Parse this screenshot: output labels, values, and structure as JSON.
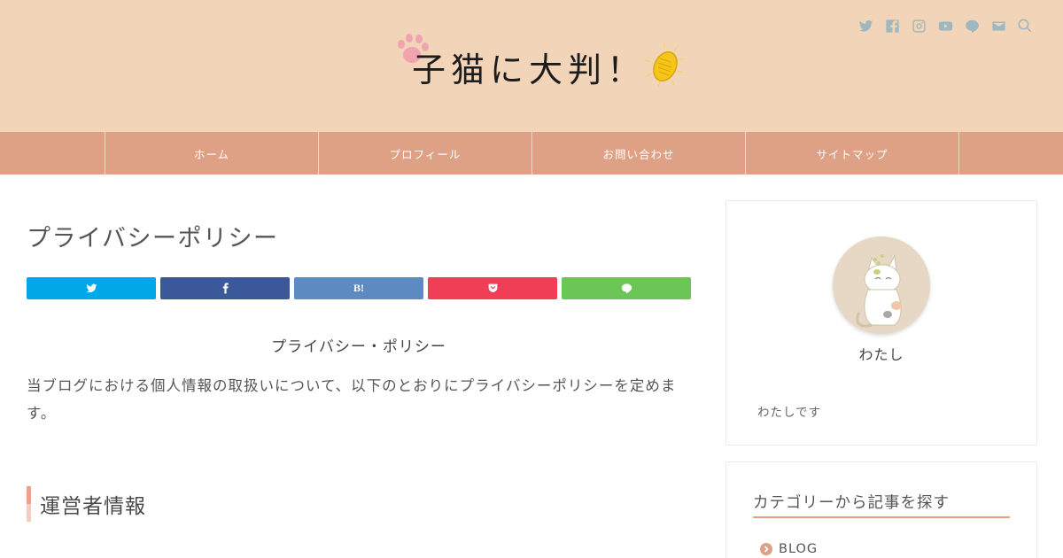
{
  "site": {
    "logo_text": "子猫に大判！"
  },
  "social_icons": [
    "twitter-icon",
    "facebook-icon",
    "instagram-icon",
    "youtube-icon",
    "line-icon",
    "mail-icon",
    "search-icon"
  ],
  "nav": {
    "items": [
      "ホーム",
      "プロフィール",
      "お問い合わせ",
      "サイトマップ"
    ]
  },
  "article": {
    "title": "プライバシーポリシー",
    "share_buttons": [
      {
        "name": "twitter",
        "color": "#00a8e8"
      },
      {
        "name": "facebook",
        "color": "#3b5998"
      },
      {
        "name": "hatena",
        "color": "#5d8ac1",
        "label": "B!"
      },
      {
        "name": "pocket",
        "color": "#ef3e56"
      },
      {
        "name": "line",
        "color": "#6cc655"
      }
    ],
    "center_heading": "プライバシー・ポリシー",
    "intro": "当ブログにおける個人情報の取扱いについて、以下のとおりにプライバシーポリシーを定めます。",
    "section_heading": "運営者情報"
  },
  "sidebar": {
    "profile": {
      "name": "わたし",
      "description": "わたしです"
    },
    "category": {
      "heading": "カテゴリーから記事を探す",
      "items": [
        "BLOG"
      ]
    }
  },
  "colors": {
    "header_bg": "#f2d4b8",
    "nav_bg": "#dfa186",
    "accent": "#dfa186",
    "social_icon": "#9fb8bf"
  }
}
